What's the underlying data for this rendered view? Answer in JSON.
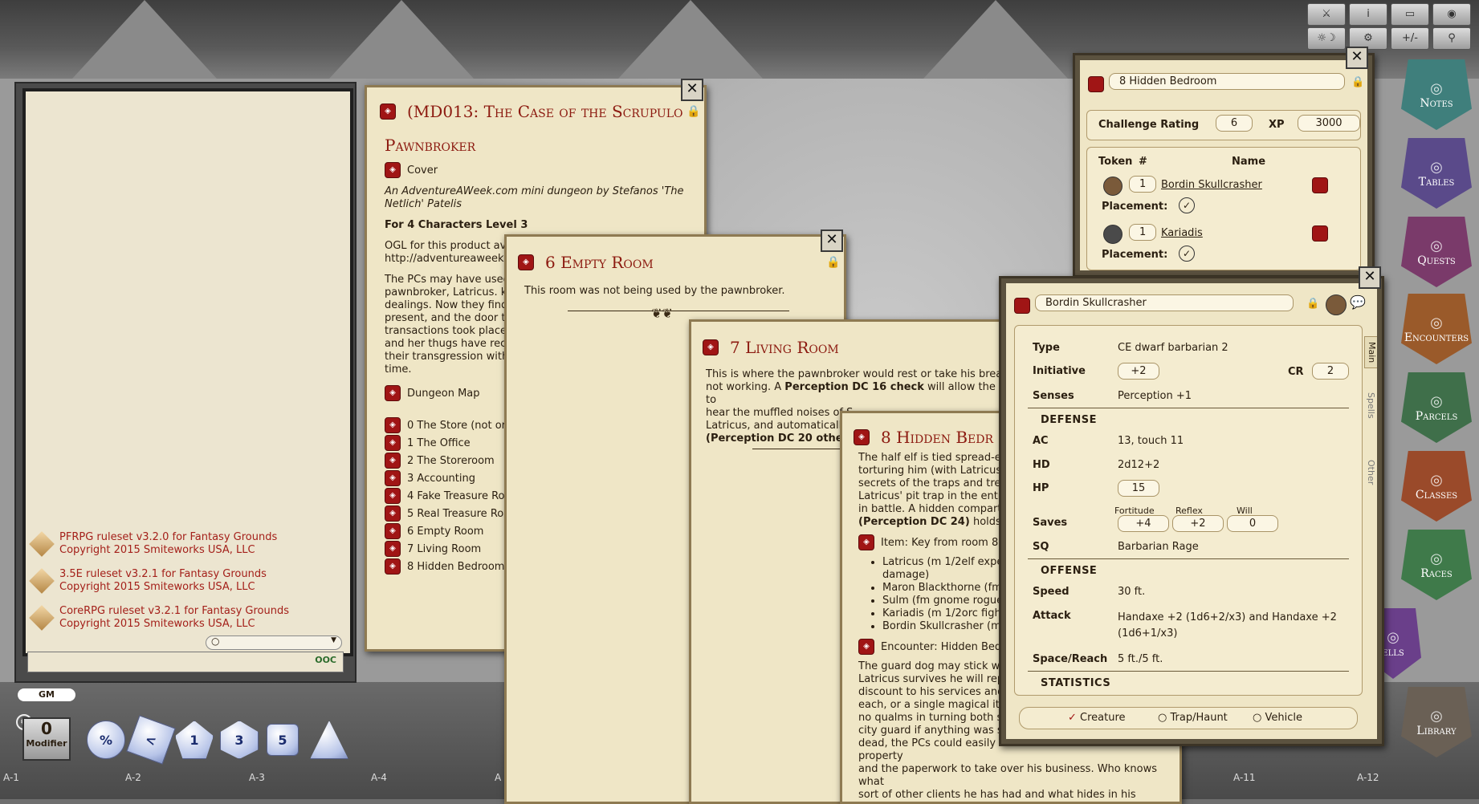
{
  "toolbar": {
    "buttons": [
      {
        "icon": "swords-icon",
        "glyph": "⚔"
      },
      {
        "icon": "info-icon",
        "glyph": "i"
      },
      {
        "icon": "map-icon",
        "glyph": "▭"
      },
      {
        "icon": "camera-icon",
        "glyph": "◉"
      },
      {
        "icon": "day-night-icon",
        "glyph": "☼☽"
      },
      {
        "icon": "settings-icon",
        "glyph": "⚙"
      },
      {
        "icon": "modifier-icon",
        "glyph": "+/-"
      },
      {
        "icon": "figure-icon",
        "glyph": "⚲"
      }
    ]
  },
  "sidebar": {
    "items": [
      {
        "label": "Notes",
        "color": "#3f7f7c"
      },
      {
        "label": "Tables",
        "color": "#5a4a8a"
      },
      {
        "label": "Quests",
        "color": "#7a3a6a"
      },
      {
        "label": "Encounters",
        "color": "#9a5a2a"
      },
      {
        "label": "Parcels",
        "color": "#3f6f4a"
      },
      {
        "label": "Classes",
        "color": "#9a4a2a"
      },
      {
        "label": "Races",
        "color": "#3f7a4a"
      },
      {
        "label": "ells",
        "color": "#6a3f8a"
      },
      {
        "label": "Library",
        "color": "#6a6055"
      }
    ]
  },
  "chat": {
    "entries": [
      {
        "line1": "PFRPG ruleset v3.2.0 for Fantasy Grounds",
        "line2": "Copyright 2015 Smiteworks USA, LLC"
      },
      {
        "line1": "3.5E ruleset v3.2.1 for Fantasy Grounds",
        "line2": "Copyright 2015 Smiteworks USA, LLC"
      },
      {
        "line1": "CoreRPG ruleset v3.2.1 for Fantasy Grounds",
        "line2": "Copyright 2015 Smiteworks USA, LLC"
      }
    ],
    "ooc_label": "OOC"
  },
  "gm": {
    "label": "GM",
    "modifier_value": "0",
    "modifier_label": "Modifier"
  },
  "dice": [
    "%",
    "<",
    "1",
    "3",
    "5",
    ""
  ],
  "grid_labels": [
    "A-1",
    "A-2",
    "A-3",
    "A-4",
    "A",
    "A-11",
    "A-12"
  ],
  "story": {
    "title": "(MD013: The Case of the Scrupulo",
    "heading": "Pawnbroker",
    "cover": "Cover",
    "byline": "An AdventureAWeek.com mini dungeon by Stefanos 'The Netlich' Patelis",
    "level": "For 4 Characters Level 3",
    "ogl1": "OGL for this product avail",
    "ogl2": "http://adventureaweek.c",
    "para": [
      "The PCs may have used t",
      "pawnbroker, Latricus. kn",
      "dealings. Now they find I",
      "present, and the door to",
      "transactions took place) ..",
      "and her thugs have recei",
      "their transgression with",
      "time."
    ],
    "dungeon_map": "Dungeon Map",
    "rooms": [
      "0 The Store (not or",
      "1 The Office",
      "2 The Storeroom",
      "3 Accounting",
      "4 Fake Treasure Ro",
      "5 Real Treasure Ro",
      "6 Empty Room",
      "7 Living Room",
      "8 Hidden Bedroom"
    ]
  },
  "empty_room": {
    "title": "6 Empty Room",
    "text": "This room was not being used by the pawnbroker."
  },
  "living_room": {
    "title": "7 Living Room",
    "lines": [
      "This is where the pawnbroker would rest or take his break if",
      "not working. A",
      "Perception DC 16 check",
      "will allow the PCs to",
      "hear the muffled noises of S",
      "Latricus, and automatically f",
      "(Perception DC 20 otherwis"
    ]
  },
  "hidden_bedroom": {
    "title": "8 Hidden Bedr",
    "para": [
      "The half elf is tied spread-eag",
      "torturing him (with Latricus'",
      "secrets of the traps and treas",
      "Latricus' pit trap in the entra",
      "in battle. A hidden compartm"
    ],
    "perception": "(Perception DC 24)",
    "perception_rest": "holds the",
    "item": "Item: Key from room 8",
    "bullets": [
      "Latricus (m 1/2elf exper",
      "damage)",
      "Maron Blackthorne (fm",
      "Sulm (fm gnome rogue",
      "Kariadis (m 1/2orc fighte",
      "Bordin Skullcrasher (m"
    ],
    "encounter": "Encounter: Hidden Bed",
    "ending": [
      "The guard dog may stick with",
      "Latricus survives he will repa",
      "discount to his services and w",
      "each, or a single magical item",
      "no qualms in turning both su",
      "city guard if anything was stolen from his inventory. If he is",
      "dead, the PCs could easily discover the deeds to the property",
      "and the paperwork to take over his business. Who knows what",
      "sort of other clients he has had and what hides in his"
    ]
  },
  "encounter": {
    "name": "8 Hidden Bedroom",
    "cr_label": "Challenge Rating",
    "cr_value": "6",
    "xp_label": "XP",
    "xp_value": "3000",
    "col_token": "Token",
    "col_num": "#",
    "col_name": "Name",
    "placement_label": "Placement:",
    "npcs": [
      {
        "count": "1",
        "name": "Bordin Skullcrasher"
      },
      {
        "count": "1",
        "name": "Kariadis"
      }
    ]
  },
  "npc": {
    "name": "Bordin Skullcrasher",
    "tabs": [
      "Main",
      "Spells",
      "Other"
    ],
    "type_label": "Type",
    "type_value": "CE dwarf barbarian 2",
    "init_label": "Initiative",
    "init_value": "+2",
    "cr_label": "CR",
    "cr_value": "2",
    "senses_label": "Senses",
    "senses_value": "Perception +1",
    "defense": "DEFENSE",
    "ac_label": "AC",
    "ac_value": "13, touch 11",
    "hd_label": "HD",
    "hd_value": "2d12+2",
    "hp_label": "HP",
    "hp_value": "15",
    "saves_label": "Saves",
    "fort_label": "Fortitude",
    "fort_value": "+4",
    "ref_label": "Reflex",
    "ref_value": "+2",
    "will_label": "Will",
    "will_value": "0",
    "sq_label": "SQ",
    "sq_value": "Barbarian Rage",
    "offense": "OFFENSE",
    "speed_label": "Speed",
    "speed_value": "30 ft.",
    "attack_label": "Attack",
    "attack_value1": "Handaxe +2 (1d6+2/x3) and Handaxe +2",
    "attack_value2": "(1d6+1/x3)",
    "space_label": "Space/Reach",
    "space_value": "5 ft./5 ft.",
    "statistics": "STATISTICS",
    "modes": [
      "Creature",
      "Trap/Haunt",
      "Vehicle"
    ]
  }
}
